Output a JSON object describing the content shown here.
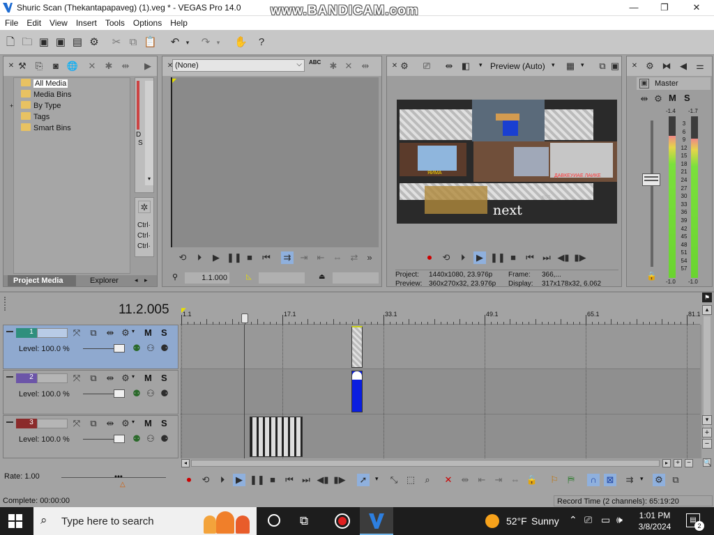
{
  "title_bar": {
    "title": "Shuric Scan (Thekantapapaveg) (1).veg * - VEGAS Pro 14.0",
    "watermark": "www.BANDICAM.com",
    "minimize_glyph": "—",
    "maximize_glyph": "❐",
    "close_glyph": "✕"
  },
  "menu": [
    "File",
    "Edit",
    "View",
    "Insert",
    "Tools",
    "Options",
    "Help"
  ],
  "project_media": {
    "tree": [
      {
        "label": "All Media",
        "expander": ""
      },
      {
        "label": "Media Bins",
        "expander": ""
      },
      {
        "label": "By Type",
        "expander": "+"
      },
      {
        "label": "Tags",
        "expander": ""
      },
      {
        "label": "Smart Bins",
        "expander": ""
      }
    ],
    "side_text": [
      "D",
      "S"
    ],
    "ctrl_text": [
      "Ctrl·",
      "Ctrl·",
      "Ctrl·"
    ],
    "tab_project": "Project Media",
    "tab_explorer": "Explorer"
  },
  "trimmer": {
    "dropdown_value": "(None)",
    "abc_label": "ABC",
    "time": "1.1.000"
  },
  "preview": {
    "mode": "Preview (Auto)",
    "overlay_text": "next",
    "project_label": "Project:",
    "project_value": "1440x1080, 23.976p",
    "preview_label": "Preview:",
    "preview_value": "360x270x32, 23.976p",
    "frame_label": "Frame:",
    "frame_value": "366,...",
    "display_label": "Display:",
    "display_value": "317x178x32, 6.062",
    "clip_text_left": "ЯИМА",
    "clip_text_right": "ДАВКЕУИАЕ ЛАИКЕ",
    "screen_text": "KOT"
  },
  "master": {
    "label": "Master",
    "m": "M",
    "s": "S",
    "peak_left": "-1.4",
    "peak_right": "-1.7",
    "scale": [
      "3",
      "6",
      "9",
      "12",
      "15",
      "18",
      "21",
      "24",
      "27",
      "30",
      "33",
      "36",
      "39",
      "42",
      "45",
      "48",
      "51",
      "54",
      "57"
    ],
    "level_left": 0.88,
    "level_right": 0.86,
    "bottom_left": "-1.0",
    "bottom_right": "-1.0"
  },
  "timeline": {
    "timecode": "11.2.005",
    "ruler": [
      "1.1",
      "17.1",
      "33.1",
      "49.1",
      "65.1",
      "81.1"
    ],
    "tracks": [
      {
        "number": "1",
        "level": "Level: 100.0 %",
        "m": "M",
        "s": "S",
        "color": "#2f8f7d"
      },
      {
        "number": "2",
        "level": "Level: 100.0 %",
        "m": "M",
        "s": "S",
        "color": "#6c55a8"
      },
      {
        "number": "3",
        "level": "Level: 100.0 %",
        "m": "M",
        "s": "S",
        "color": "#8b2b2b"
      }
    ],
    "rate": "Rate: 1.00",
    "complete": "Complete: 00:00:00",
    "record_time": "Record Time (2 channels): 65:19:20"
  },
  "taskbar": {
    "search_placeholder": "Type here to search",
    "temperature": "52°F",
    "weather": "Sunny",
    "time": "1:01 PM",
    "date": "3/8/2024",
    "notification_count": "2"
  },
  "colors": {
    "ui_grey": "#a3a3a3",
    "selected_track": "#8fa9cf",
    "meter_green": "#7be03c",
    "meter_yellow": "#e6d54a",
    "clip_blue": "#0a1ee0",
    "taskbar": "#1d1d1d"
  }
}
